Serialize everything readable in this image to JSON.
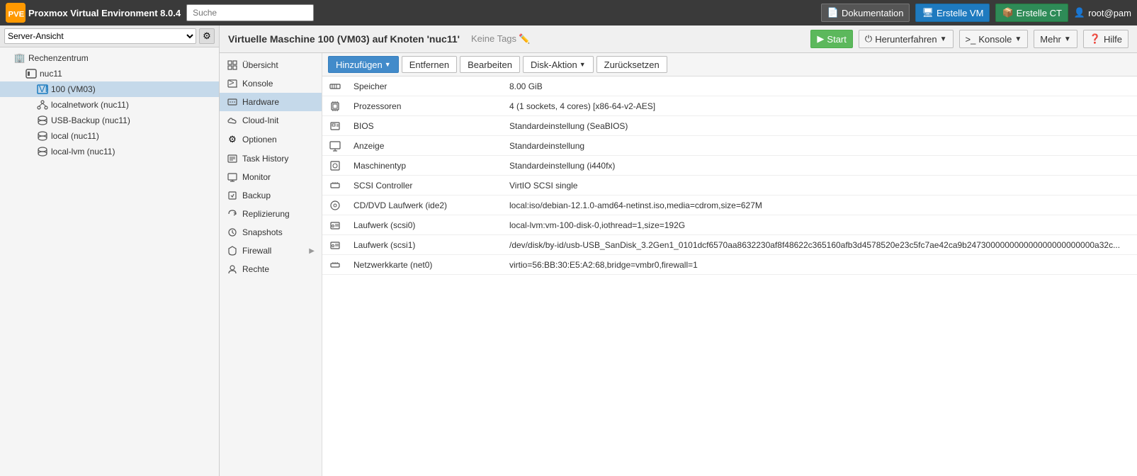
{
  "app": {
    "title": "Proxmox Virtual Environment 8.0.4",
    "version": "8.0.4"
  },
  "topbar": {
    "search_placeholder": "Suche",
    "doc_btn": "Dokumentation",
    "create_vm_btn": "Erstelle VM",
    "create_ct_btn": "Erstelle CT",
    "user": "root@pam"
  },
  "left_panel": {
    "server_view_label": "Server-Ansicht",
    "tree": [
      {
        "id": "rechenzentrum",
        "label": "Rechenzentrum",
        "indent": 0,
        "type": "datacenter"
      },
      {
        "id": "nuc11",
        "label": "nuc11",
        "indent": 1,
        "type": "node"
      },
      {
        "id": "100-vm03",
        "label": "100 (VM03)",
        "indent": 2,
        "type": "vm",
        "selected": true
      },
      {
        "id": "localnetwork",
        "label": "localnetwork (nuc11)",
        "indent": 2,
        "type": "network"
      },
      {
        "id": "usb-backup",
        "label": "USB-Backup (nuc11)",
        "indent": 2,
        "type": "storage"
      },
      {
        "id": "local",
        "label": "local (nuc11)",
        "indent": 2,
        "type": "storage"
      },
      {
        "id": "local-lvm",
        "label": "local-lvm (nuc11)",
        "indent": 2,
        "type": "storage"
      }
    ]
  },
  "page_header": {
    "title": "Virtuelle Maschine 100 (VM03) auf Knoten 'nuc11'",
    "tags_label": "Keine Tags",
    "start_btn": "Start",
    "shutdown_btn": "Herunterfahren",
    "console_btn": "Konsole",
    "more_btn": "Mehr",
    "help_btn": "Hilfe"
  },
  "nav_items": [
    {
      "id": "uebersicht",
      "label": "Übersicht",
      "icon": "overview"
    },
    {
      "id": "konsole",
      "label": "Konsole",
      "icon": "console"
    },
    {
      "id": "hardware",
      "label": "Hardware",
      "icon": "hardware",
      "active": true
    },
    {
      "id": "cloud-init",
      "label": "Cloud-Init",
      "icon": "cloud"
    },
    {
      "id": "optionen",
      "label": "Optionen",
      "icon": "options"
    },
    {
      "id": "task-history",
      "label": "Task History",
      "icon": "taskhistory"
    },
    {
      "id": "monitor",
      "label": "Monitor",
      "icon": "monitor"
    },
    {
      "id": "backup",
      "label": "Backup",
      "icon": "backup"
    },
    {
      "id": "replizierung",
      "label": "Replizierung",
      "icon": "replicate"
    },
    {
      "id": "snapshots",
      "label": "Snapshots",
      "icon": "snapshot"
    },
    {
      "id": "firewall",
      "label": "Firewall",
      "icon": "firewall",
      "has_arrow": true
    },
    {
      "id": "rechte",
      "label": "Rechte",
      "icon": "rights"
    }
  ],
  "toolbar": {
    "add_btn": "Hinzufügen",
    "remove_btn": "Entfernen",
    "edit_btn": "Bearbeiten",
    "disk_action_btn": "Disk-Aktion",
    "reset_btn": "Zurücksetzen"
  },
  "hardware_rows": [
    {
      "id": "speicher",
      "icon": "memory",
      "name": "Speicher",
      "value": "8.00 GiB"
    },
    {
      "id": "prozessoren",
      "icon": "cpu",
      "name": "Prozessoren",
      "value": "4 (1 sockets, 4 cores) [x86-64-v2-AES]"
    },
    {
      "id": "bios",
      "icon": "bios",
      "name": "BIOS",
      "value": "Standardeinstellung (SeaBIOS)"
    },
    {
      "id": "anzeige",
      "icon": "display",
      "name": "Anzeige",
      "value": "Standardeinstellung"
    },
    {
      "id": "maschinentyp",
      "icon": "machine",
      "name": "Maschinentyp",
      "value": "Standardeinstellung (i440fx)"
    },
    {
      "id": "scsi-controller",
      "icon": "scsi",
      "name": "SCSI Controller",
      "value": "VirtIO SCSI single"
    },
    {
      "id": "cdrom",
      "icon": "cdrom",
      "name": "CD/DVD Laufwerk (ide2)",
      "value": "local:iso/debian-12.1.0-amd64-netinst.iso,media=cdrom,size=627M"
    },
    {
      "id": "disk-scsi0",
      "icon": "disk",
      "name": "Laufwerk (scsi0)",
      "value": "local-lvm:vm-100-disk-0,iothread=1,size=192G"
    },
    {
      "id": "disk-scsi1",
      "icon": "disk",
      "name": "Laufwerk (scsi1)",
      "value": "/dev/disk/by-id/usb-USB_SanDisk_3.2Gen1_0101dcf6570aa8632230af8f48622c365160afb3d4578520e23c5fc7ae42ca9b247300000000000000000000000a32c..."
    },
    {
      "id": "netzwerkkarte",
      "icon": "net",
      "name": "Netzwerkkarte (net0)",
      "value": "virtio=56:BB:30:E5:A2:68,bridge=vmbr0,firewall=1"
    }
  ]
}
